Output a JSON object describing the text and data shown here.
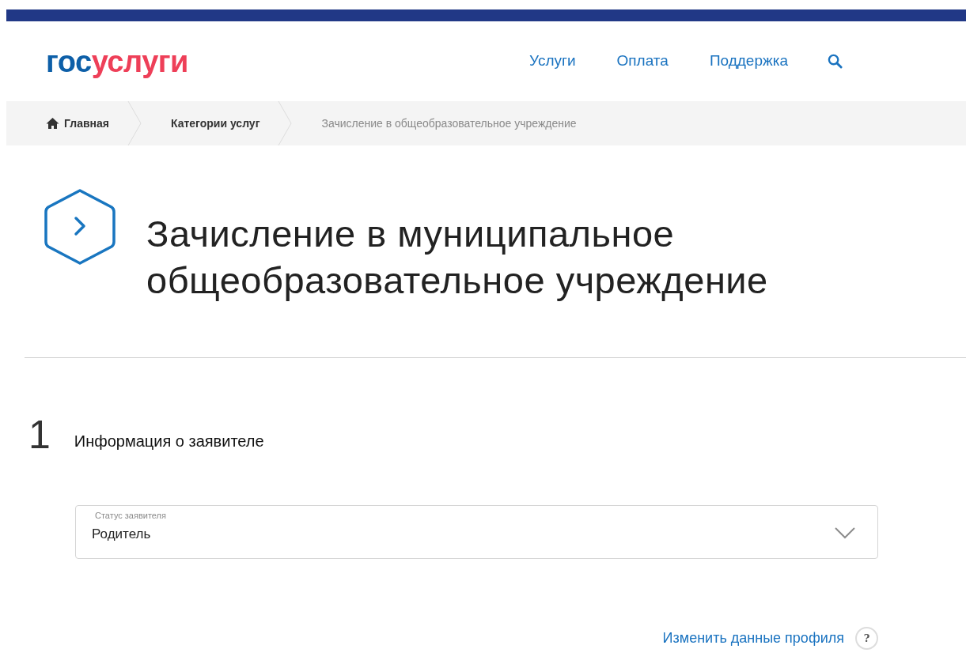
{
  "logo": {
    "parts": [
      {
        "text": "гос",
        "color": "#0d5fa8"
      },
      {
        "text": "услуги",
        "color": "#ee3f58"
      }
    ]
  },
  "nav": {
    "items": [
      {
        "label": "Услуги"
      },
      {
        "label": "Оплата"
      },
      {
        "label": "Поддержка"
      }
    ]
  },
  "breadcrumbs": [
    {
      "label": "Главная",
      "kind": "home",
      "current": false
    },
    {
      "label": "Категории услуг",
      "kind": "link",
      "current": false
    },
    {
      "label": "Зачисление в общеобразовательное учреждение",
      "kind": "link",
      "current": true
    }
  ],
  "page_title": [
    "Зачисление в муниципальное",
    "общеобразовательное учреждение"
  ],
  "step": {
    "number": "1",
    "title": "Информация о заявителе"
  },
  "applicant_status": {
    "label": "Статус заявителя",
    "value": "Родитель"
  },
  "profile_link": {
    "label": "Изменить данные профиля",
    "help": "?"
  }
}
